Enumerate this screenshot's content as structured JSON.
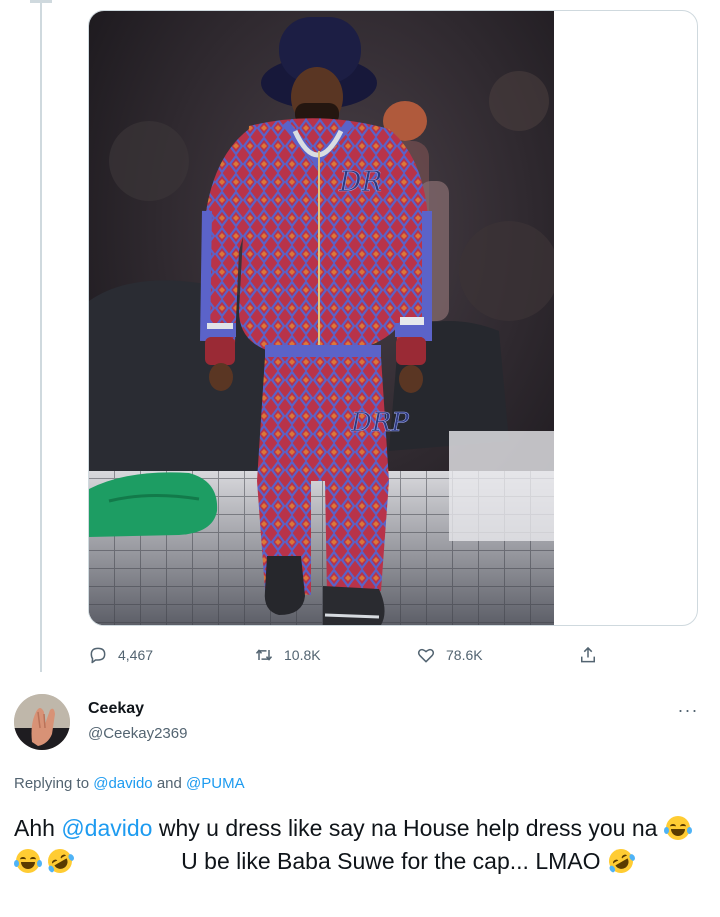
{
  "original_tweet": {
    "stats": {
      "replies": "4,467",
      "retweets": "10.8K",
      "likes": "78.6K"
    },
    "icons": {
      "reply": "speech-bubble-icon",
      "retweet": "retweet-icon",
      "like": "heart-icon",
      "share": "share-upload-icon"
    }
  },
  "reply_tweet": {
    "display_name": "Ceekay",
    "handle": "@Ceekay2369",
    "more_label": "···",
    "replying_prefix": "Replying to",
    "replying_to_1": "@davido",
    "replying_and": "and",
    "replying_to_2": "@PUMA",
    "text_part1": "Ahh",
    "text_mention": "@davido",
    "text_part2": "why u dress like say na House help dress you na",
    "text_part3": "U be like Baba Suwe for the cap... LMAO",
    "emojis": [
      "face-with-tears-of-joy",
      "face-with-tears-of-joy",
      "rolling-on-floor-laughing",
      "rolling-on-floor-laughing"
    ]
  },
  "colors": {
    "link": "#1d9bf0",
    "secondary_text": "#536471",
    "border": "#cfd9de"
  }
}
